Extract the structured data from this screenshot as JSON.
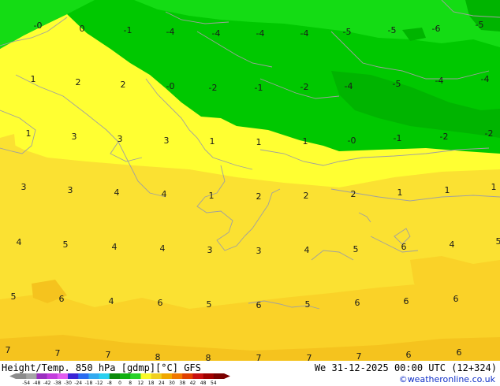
{
  "footer": {
    "title": "Height/Temp. 850 hPa [gdmp][°C] GFS",
    "datetime": "We 31-12-2025 00:00 UTC (12+324)",
    "credit": "©weatheronline.co.uk"
  },
  "colorbar": {
    "ticks": [
      "-54",
      "-48",
      "-42",
      "-38",
      "-30",
      "-24",
      "-18",
      "-12",
      "-8",
      "0",
      "8",
      "12",
      "18",
      "24",
      "30",
      "38",
      "42",
      "48",
      "54"
    ],
    "colors": [
      "#8c8c8c",
      "#a6a6a6",
      "#9b2fbf",
      "#c33cdc",
      "#e25cf0",
      "#3a23d6",
      "#2a6cf0",
      "#33aaf0",
      "#2ad0f0",
      "#0a8a0a",
      "#10b010",
      "#28d228",
      "#fafa28",
      "#f0d020",
      "#f0a800",
      "#f07800",
      "#e04000",
      "#c81010",
      "#a00000",
      "#7a0000"
    ]
  },
  "map_colors": {
    "green_dark": "#00b400",
    "green": "#00c800",
    "green_light": "#14dc14",
    "yellow": "#ffff32",
    "yellow_orange": "#fbe132",
    "orange": "#fad228",
    "orange_deep": "#f5c31e",
    "border": "#a0a0a0"
  },
  "temperature_labels": [
    "-0",
    "0",
    "-1",
    "-4",
    "-4",
    "-4",
    "-4",
    "-5",
    "-5",
    "-6",
    "-5",
    "1",
    "2",
    "2",
    "-0",
    "-2",
    "-1",
    "-2",
    "-4",
    "-5",
    "-4",
    "-4",
    "1",
    "3",
    "3",
    "3",
    "1",
    "1",
    "1",
    "-0",
    "-1",
    "-2",
    "-2",
    "3",
    "3",
    "4",
    "4",
    "1",
    "2",
    "2",
    "2",
    "1",
    "1",
    "1",
    "4",
    "5",
    "4",
    "4",
    "3",
    "3",
    "4",
    "5",
    "6",
    "4",
    "5",
    "5",
    "6",
    "4",
    "6",
    "5",
    "6",
    "5",
    "6",
    "6",
    "6",
    "7",
    "7",
    "7",
    "8",
    "8",
    "7",
    "7",
    "7",
    "6",
    "6"
  ]
}
